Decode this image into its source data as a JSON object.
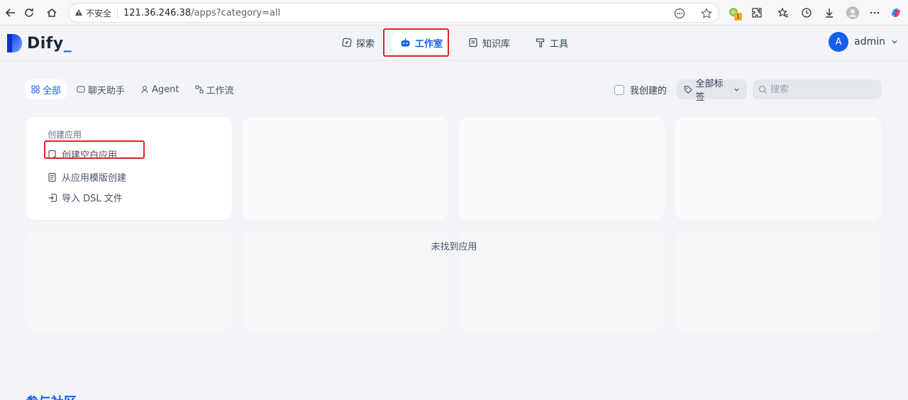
{
  "browser": {
    "insecure_label": "不安全",
    "url_host": "121.36.246.38",
    "url_path": "/apps?category=all",
    "extension_badge": "1"
  },
  "app": {
    "logo_text": "Dify",
    "logo_underscore": "_",
    "nav": [
      {
        "label": "探索",
        "icon": "compass-icon"
      },
      {
        "label": "工作室",
        "icon": "robot-icon",
        "active": true
      },
      {
        "label": "知识库",
        "icon": "book-icon"
      },
      {
        "label": "工具",
        "icon": "hammer-icon"
      }
    ],
    "user": {
      "avatar_initial": "A",
      "name": "admin"
    }
  },
  "filters": {
    "categories": [
      {
        "label": "全部",
        "icon": "grid-icon",
        "active": true
      },
      {
        "label": "聊天助手",
        "icon": "chat-icon"
      },
      {
        "label": "Agent",
        "icon": "agent-icon"
      },
      {
        "label": "工作流",
        "icon": "workflow-icon"
      }
    ],
    "my_created_label": "我创建的",
    "tag_filter_label": "全部标签",
    "search_placeholder": "搜索"
  },
  "create_card": {
    "title": "创建应用",
    "items": [
      {
        "label": "创建空白应用",
        "icon": "file-plus-icon"
      },
      {
        "label": "从应用模版创建",
        "icon": "template-icon"
      },
      {
        "label": "导入 DSL 文件",
        "icon": "import-icon"
      }
    ]
  },
  "empty_state": "未找到应用",
  "community_heading": "参与社区",
  "colors": {
    "accent": "#155eef",
    "highlight": "#e02424",
    "background": "#f2f4f7"
  }
}
